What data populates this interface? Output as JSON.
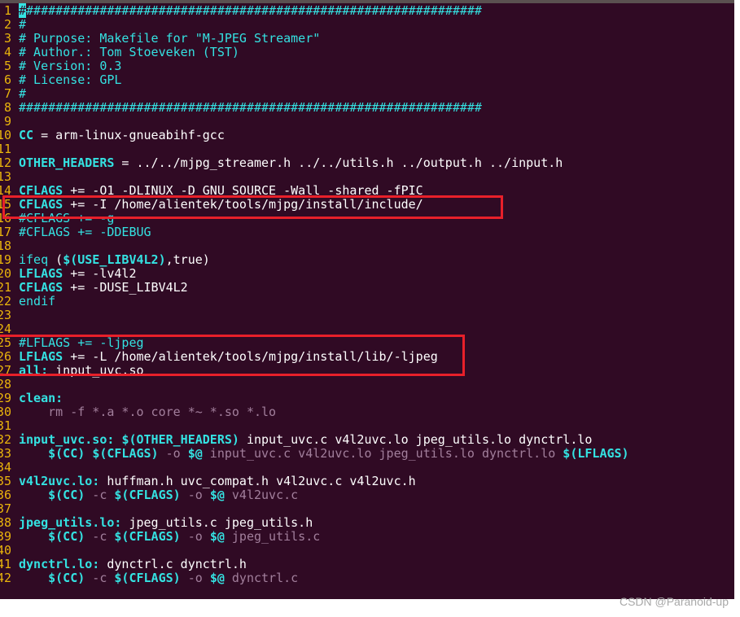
{
  "editor": {
    "colors": {
      "background": "#300a24",
      "line_number": "#e9b40c",
      "keyword": "#34e2e2",
      "text": "#ffffff",
      "recipe": "#a27f9c",
      "highlight_box": "#e8202a"
    },
    "cursor": {
      "line": 1,
      "column": 1
    },
    "lines": [
      [
        [
          "c",
          "#"
        ],
        [
          "c",
          "##############################################################"
        ]
      ],
      [
        [
          "c",
          "#"
        ]
      ],
      [
        [
          "c",
          "# Purpose: Makefile for \"M-JPEG Streamer\""
        ]
      ],
      [
        [
          "c",
          "# Author.: Tom Stoeveken (TST)"
        ]
      ],
      [
        [
          "c",
          "# Version: 0.3"
        ]
      ],
      [
        [
          "c",
          "# License: GPL"
        ]
      ],
      [
        [
          "c",
          "#"
        ]
      ],
      [
        [
          "c",
          "###############################################################"
        ]
      ],
      [],
      [
        [
          "v",
          "CC"
        ],
        [
          "w",
          " = arm-linux-gnueabihf-gcc"
        ]
      ],
      [],
      [
        [
          "v",
          "OTHER_HEADERS"
        ],
        [
          "w",
          " = ../../mjpg_streamer.h ../../utils.h ../output.h ../input.h"
        ]
      ],
      [],
      [
        [
          "v",
          "CFLAGS"
        ],
        [
          "w",
          " += -O1 -DLINUX -D_GNU_SOURCE -Wall -shared -fPIC"
        ]
      ],
      [
        [
          "v",
          "CFLAGS"
        ],
        [
          "w",
          " += -I /home/alientek/tools/mjpg/install/include/"
        ]
      ],
      [
        [
          "c",
          "#CFLAGS += -g"
        ]
      ],
      [
        [
          "c",
          "#CFLAGS += -DDEBUG"
        ]
      ],
      [],
      [
        [
          "c",
          "ifeq "
        ],
        [
          "w",
          "("
        ],
        [
          "v",
          "$(USE_LIBV4L2)"
        ],
        [
          "w",
          ",true)"
        ]
      ],
      [
        [
          "v",
          "LFLAGS"
        ],
        [
          "w",
          " += -lv4l2"
        ]
      ],
      [
        [
          "v",
          "CFLAGS"
        ],
        [
          "w",
          " += -DUSE_LIBV4L2"
        ]
      ],
      [
        [
          "c",
          "endif"
        ]
      ],
      [],
      [],
      [
        [
          "c",
          "#LFLAGS += -ljpeg"
        ]
      ],
      [
        [
          "v",
          "LFLAGS"
        ],
        [
          "w",
          " += -L /home/alientek/tools/mjpg/install/lib/-ljpeg"
        ]
      ],
      [
        [
          "v",
          "all:"
        ],
        [
          "w",
          " input_uvc.so"
        ]
      ],
      [],
      [
        [
          "v",
          "clean:"
        ]
      ],
      [
        [
          "r",
          "    rm -f *.a *.o core *~ *.so *.lo"
        ]
      ],
      [],
      [
        [
          "v",
          "input_uvc.so:"
        ],
        [
          "w",
          " "
        ],
        [
          "v",
          "$(OTHER_HEADERS)"
        ],
        [
          "w",
          " input_uvc.c v4l2uvc.lo jpeg_utils.lo dynctrl.lo"
        ]
      ],
      [
        [
          "w",
          "    "
        ],
        [
          "v",
          "$(CC)"
        ],
        [
          "w",
          " "
        ],
        [
          "v",
          "$(CFLAGS)"
        ],
        [
          "r",
          " -o "
        ],
        [
          "v",
          "$@"
        ],
        [
          "r",
          " input_uvc.c v4l2uvc.lo jpeg_utils.lo dynctrl.lo "
        ],
        [
          "v",
          "$(LFLAGS)"
        ]
      ],
      [],
      [
        [
          "v",
          "v4l2uvc.lo:"
        ],
        [
          "w",
          " huffman.h uvc_compat.h v4l2uvc.c v4l2uvc.h"
        ]
      ],
      [
        [
          "w",
          "    "
        ],
        [
          "v",
          "$(CC)"
        ],
        [
          "r",
          " -c "
        ],
        [
          "v",
          "$(CFLAGS)"
        ],
        [
          "r",
          " -o "
        ],
        [
          "v",
          "$@"
        ],
        [
          "r",
          " v4l2uvc.c"
        ]
      ],
      [],
      [
        [
          "v",
          "jpeg_utils.lo:"
        ],
        [
          "w",
          " jpeg_utils.c jpeg_utils.h"
        ]
      ],
      [
        [
          "w",
          "    "
        ],
        [
          "v",
          "$(CC)"
        ],
        [
          "r",
          " -c "
        ],
        [
          "v",
          "$(CFLAGS)"
        ],
        [
          "r",
          " -o "
        ],
        [
          "v",
          "$@"
        ],
        [
          "r",
          " jpeg_utils.c"
        ]
      ],
      [],
      [
        [
          "v",
          "dynctrl.lo:"
        ],
        [
          "w",
          " dynctrl.c dynctrl.h"
        ]
      ],
      [
        [
          "w",
          "    "
        ],
        [
          "v",
          "$(CC)"
        ],
        [
          "r",
          " -c "
        ],
        [
          "v",
          "$(CFLAGS)"
        ],
        [
          "r",
          " -o "
        ],
        [
          "v",
          "$@"
        ],
        [
          "r",
          " dynctrl.c"
        ]
      ]
    ],
    "line_numbers": [
      "1",
      "2",
      "3",
      "4",
      "5",
      "6",
      "7",
      "8",
      "9",
      "10",
      "11",
      "12",
      "13",
      "14",
      "15",
      "16",
      "17",
      "18",
      "19",
      "20",
      "21",
      "22",
      "23",
      "24",
      "25",
      "26",
      "27",
      "28",
      "29",
      "30",
      "31",
      "32",
      "33",
      "34",
      "35",
      "36",
      "37",
      "38",
      "39",
      "40",
      "41",
      "42"
    ]
  },
  "watermark": "CSDN @Paranoid-up"
}
